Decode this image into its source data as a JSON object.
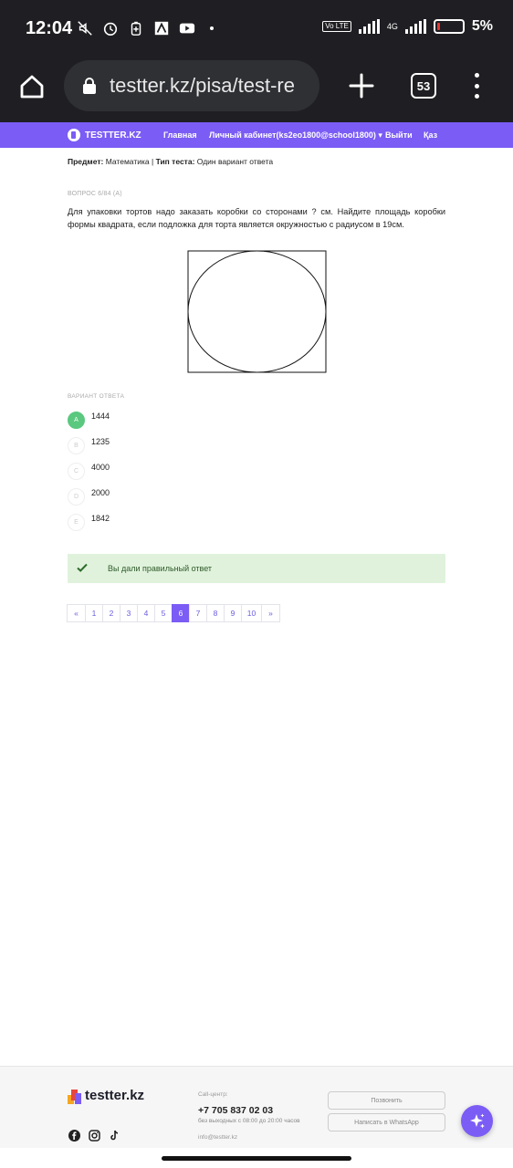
{
  "status_bar": {
    "time": "12:04",
    "network": "4G",
    "volte": "Vo LTE",
    "battery": "5%",
    "icons": [
      "mute-icon",
      "alarm-icon",
      "battery-saver-icon",
      "app-icon",
      "youtube-icon"
    ]
  },
  "browser": {
    "url": "testter.kz/pisa/test-re",
    "tab_count": "53"
  },
  "site_nav": {
    "brand": "TESTTER.KZ",
    "items": [
      "Главная",
      "Личный кабинет(ks2eo1800@school1800) ▾",
      "Выйти",
      "Қаз"
    ]
  },
  "meta": {
    "subject_label": "Предмет:",
    "subject_value": "Математика",
    "separator": "|",
    "type_label": "Тип теста:",
    "type_value": "Один вариант ответа"
  },
  "question": {
    "label": "ВОПРОС 6/84 (A)",
    "text": "Для упаковки тортов надо заказать коробки со сторонами ? см.  Найдите площадь коробки формы квадрата, если подложка для торта является окружностью с радиусом в 19см."
  },
  "answers": {
    "label": "ВАРИАНТ ОТВЕТА",
    "options": [
      {
        "letter": "A",
        "value": "1444",
        "correct": true
      },
      {
        "letter": "B",
        "value": "1235",
        "correct": false
      },
      {
        "letter": "C",
        "value": "4000",
        "correct": false
      },
      {
        "letter": "D",
        "value": "2000",
        "correct": false
      },
      {
        "letter": "E",
        "value": "1842",
        "correct": false
      }
    ]
  },
  "result": {
    "text": "Вы дали правильный ответ"
  },
  "pagination": {
    "prev": "«",
    "pages": [
      "1",
      "2",
      "3",
      "4",
      "5",
      "6",
      "7",
      "8",
      "9",
      "10"
    ],
    "next": "»",
    "current": "6"
  },
  "footer": {
    "brand": "testter.kz",
    "callcenter_label": "Call-центр:",
    "phone": "+7 705 837 02 03",
    "hours": "без выходных с 08:00 до 20:00 часов",
    "email": "info@testter.kz",
    "call_button": "Позвонить",
    "whatsapp_button": "Написать в WhatsApp",
    "social": [
      "facebook-icon",
      "instagram-icon",
      "tiktok-icon"
    ]
  },
  "colors": {
    "accent": "#7b5cf5",
    "correct": "#5ac87e",
    "success_bg": "#e0f2dc",
    "status_bar_bg": "#1f1f23"
  }
}
